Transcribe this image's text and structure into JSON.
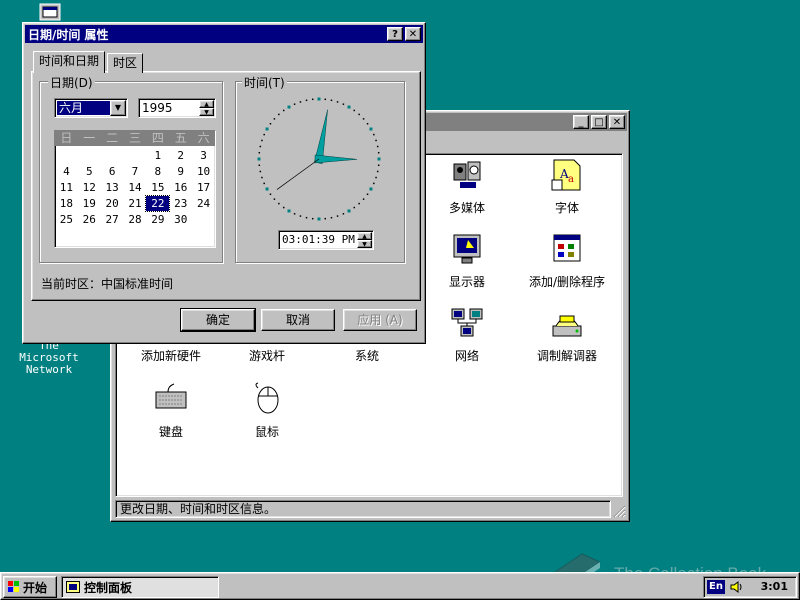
{
  "desktop": {
    "msn_icon_label": [
      "The",
      "Microsoft",
      "Network"
    ]
  },
  "control_panel": {
    "status_text": "更改日期、时间和时区信息。",
    "items": [
      {
        "label": "多媒体",
        "icon": "multimedia-icon"
      },
      {
        "label": "字体",
        "icon": "fonts-icon"
      },
      {
        "label": "显示器",
        "icon": "display-icon"
      },
      {
        "label": "添加/删除程序",
        "icon": "add-remove-programs-icon"
      },
      {
        "label": "添加新硬件",
        "icon": "add-hardware-icon"
      },
      {
        "label": "游戏杆",
        "icon": "joystick-icon"
      },
      {
        "label": "系统",
        "icon": "system-icon"
      },
      {
        "label": "网络",
        "icon": "network-icon"
      },
      {
        "label": "调制解调器",
        "icon": "modem-icon"
      },
      {
        "label": "键盘",
        "icon": "keyboard-icon"
      },
      {
        "label": "鼠标",
        "icon": "mouse-icon"
      }
    ]
  },
  "dialog": {
    "title": "日期/时间 属性",
    "tabs": [
      "时间和日期",
      "时区"
    ],
    "date_group_label": "日期(D)",
    "time_group_label": "时间(T)",
    "month_value": "六月",
    "year_value": "1995",
    "weekdays": [
      "日",
      "一",
      "二",
      "三",
      "四",
      "五",
      "六"
    ],
    "days": [
      "",
      "",
      "",
      "",
      "1",
      "2",
      "3",
      "4",
      "5",
      "6",
      "7",
      "8",
      "9",
      "10",
      "11",
      "12",
      "13",
      "14",
      "15",
      "16",
      "17",
      "18",
      "19",
      "20",
      "21",
      "22",
      "23",
      "24",
      "25",
      "26",
      "27",
      "28",
      "29",
      "30",
      ""
    ],
    "selected_day": "22",
    "time_value": "03:01:39 PM",
    "clock": {
      "hour": 3,
      "minute": 1,
      "second": 39
    },
    "timezone_label": "当前时区：",
    "timezone_value": "中国标准时间",
    "ok_label": "确定",
    "cancel_label": "取消",
    "apply_label": "应用 (A)"
  },
  "taskbar": {
    "start_label": "开始",
    "task_label": "控制面板",
    "ime_label": "En",
    "clock": "3:01"
  },
  "watermark": "The Collection Book"
}
